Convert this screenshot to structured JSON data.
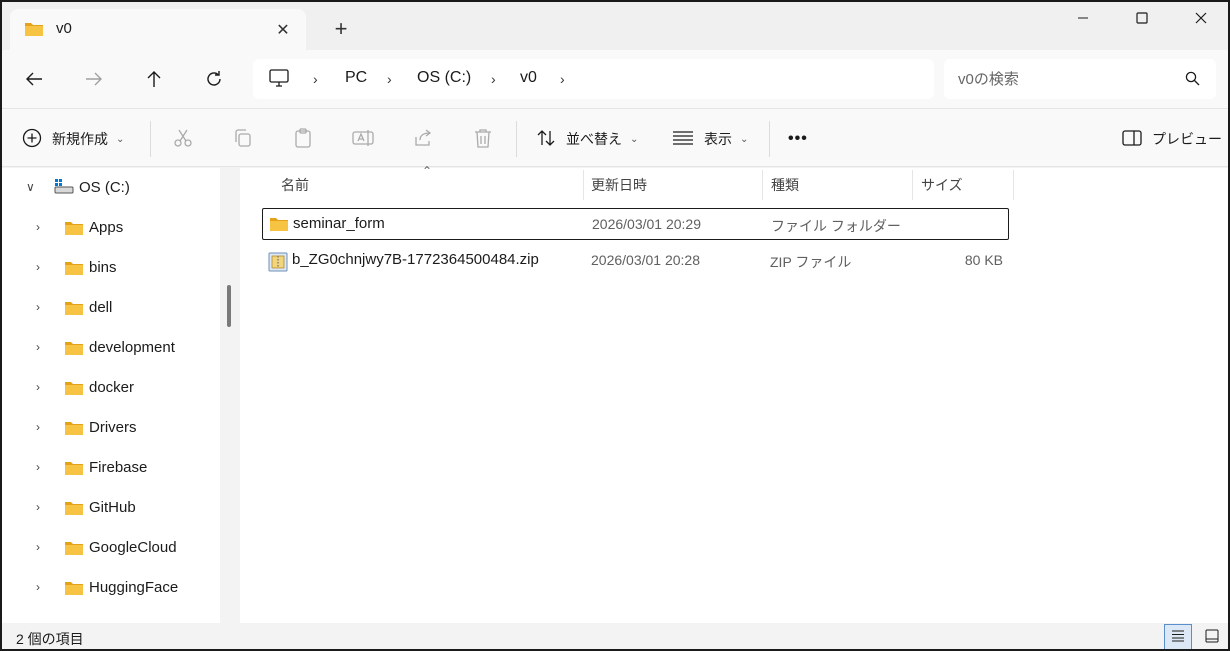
{
  "window": {
    "tab_title": "v0",
    "tab_close": "✕",
    "new_tab": "+"
  },
  "address": {
    "crumbs": [
      "PC",
      "OS (C:)",
      "v0"
    ],
    "search_placeholder": "v0の検索"
  },
  "commands": {
    "new_label": "新規作成",
    "sort_label": "並べ替え",
    "view_label": "表示",
    "more_label": "•••",
    "preview_label": "プレビュー"
  },
  "nav": {
    "root_label": "OS (C:)",
    "folders": [
      {
        "label": "Apps"
      },
      {
        "label": "bins"
      },
      {
        "label": "dell"
      },
      {
        "label": "development"
      },
      {
        "label": "docker"
      },
      {
        "label": "Drivers"
      },
      {
        "label": "Firebase"
      },
      {
        "label": "GitHub"
      },
      {
        "label": "GoogleCloud"
      },
      {
        "label": "HuggingFace"
      }
    ]
  },
  "columns": {
    "name": "名前",
    "date": "更新日時",
    "type": "種類",
    "size": "サイズ"
  },
  "files": [
    {
      "name": "seminar_form",
      "date": "2026/03/01 20:29",
      "type": "ファイル フォルダー",
      "size": "",
      "icon": "folder-icon",
      "selected": true
    },
    {
      "name": "b_ZG0chnjwy7B-1772364500484.zip",
      "date": "2026/03/01 20:28",
      "type": "ZIP ファイル",
      "size": "80 KB",
      "icon": "zip-icon",
      "selected": false
    }
  ],
  "status": {
    "item_count": "2 個の項目"
  },
  "colors": {
    "folder": "#f6c343",
    "folder_dark": "#e3a21a",
    "accent": "#005fb8"
  }
}
